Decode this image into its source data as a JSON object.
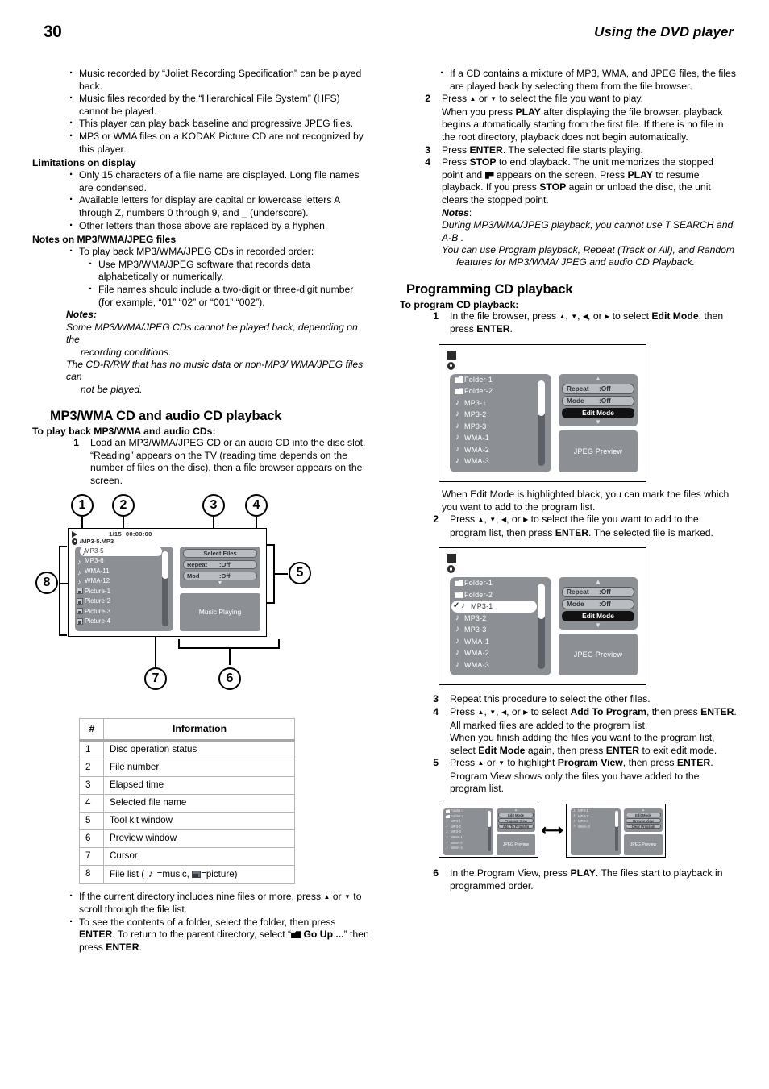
{
  "header": {
    "page_number": "30",
    "title": "Using the DVD player"
  },
  "left": {
    "top_bullets": [
      "Music recorded by “Joliet Recording Specification” can be played back.",
      "Music files recorded by the “Hierarchical File System” (HFS) cannot be played.",
      "This player can play back baseline and progressive JPEG files.",
      "MP3 or WMA files on a KODAK Picture CD are not recognized by this player."
    ],
    "limitations_heading": "Limitations on display",
    "limitations_bullets": [
      "Only 15 characters of a file name are displayed. Long file names are condensed.",
      "Available letters for display are capital or lowercase letters A through Z, numbers 0 through 9, and _ (underscore).",
      "Other letters than those above are replaced by a hyphen."
    ],
    "notes_heading": "Notes on MP3/WMA/JPEG files",
    "notes_bullet": "To play back MP3/WMA/JPEG CDs in recorded order:",
    "notes_subbullets": [
      "Use MP3/WMA/JPEG software that records data alphabetically or numerically.",
      "File names should include a two-digit or three-digit number (for example, “01” “02” or “001” “002”)."
    ],
    "notes_label": "Notes:",
    "notes_italic": [
      {
        "main": "Some MP3/WMA/JPEG CDs cannot be played back, depending on the",
        "indent": "recording conditions."
      },
      {
        "main": "The CD-R/RW that has no music data or non-MP3/ WMA/JPEG files can",
        "indent": "not be played."
      }
    ],
    "section_title": "MP3/WMA CD and audio CD playback",
    "procedure_heading": "To play back MP3/WMA and audio CDs:",
    "step1_num": "1",
    "step1_text": "Load an MP3/WMA/JPEG CD or an audio CD into the disc slot. “Reading” appears on the TV (reading time depends on the number of files on the disc), then a file browser appears on the screen.",
    "bottom_bullets": [
      {
        "pre": "If the current directory includes nine files or more, press ",
        "post": " to scroll through the file list."
      },
      {
        "pre": "To see the contents of a folder, select the folder, then press ",
        "bold1": "ENTER",
        "mid": ". To return to the parent directory, select ",
        "quote_bold": "Go Up ...",
        "post": " then press ",
        "bold2": "ENTER",
        "end": "."
      }
    ]
  },
  "diagram": {
    "callouts": [
      "1",
      "2",
      "3",
      "4",
      "5",
      "6",
      "7",
      "8"
    ],
    "status_icon": "play-icon",
    "file_number": "1/15",
    "elapsed_time": "00:00:00",
    "selected_file": "/MP3-5.MP3",
    "files": [
      {
        "label": "MP3-5",
        "kind": "music",
        "selected": true
      },
      {
        "label": "MP3-6",
        "kind": "music",
        "selected": false
      },
      {
        "label": "WMA-11",
        "kind": "music",
        "selected": false
      },
      {
        "label": "WMA-12",
        "kind": "music",
        "selected": false
      },
      {
        "label": "Picture-1",
        "kind": "picture",
        "selected": false
      },
      {
        "label": "Picture-2",
        "kind": "picture",
        "selected": false
      },
      {
        "label": "Picture-3",
        "kind": "picture",
        "selected": false
      },
      {
        "label": "Picture-4",
        "kind": "picture",
        "selected": false
      }
    ],
    "toolkit": {
      "select_files": "Select Files",
      "repeat_label": "Repeat",
      "repeat_value": ":Off",
      "mod_label": "Mod",
      "mod_value": ":Off"
    },
    "preview_text": "Music Playing"
  },
  "table": {
    "col_num": "#",
    "col_info": "Information",
    "rows": [
      {
        "n": "1",
        "info": "Disc operation status"
      },
      {
        "n": "2",
        "info": "File number"
      },
      {
        "n": "3",
        "info": "Elapsed time"
      },
      {
        "n": "4",
        "info": "Selected file name"
      },
      {
        "n": "5",
        "info": "Tool kit window"
      },
      {
        "n": "6",
        "info": "Preview window"
      },
      {
        "n": "7",
        "info": "Cursor"
      },
      {
        "n": "8",
        "info_pre": "File list ( ",
        "info_mid": " =music, ",
        "info_end": "=picture)"
      }
    ]
  },
  "right": {
    "top_bullet": "If a CD contains a mixture of MP3, WMA, and JPEG files, the files are played back by selecting them from the file browser.",
    "step2_num": "2",
    "step2_pre": "Press ",
    "step2_mid": " or ",
    "step2_post": " to select the file you want to play.",
    "step2_cont_a": "When you press ",
    "step2_cont_play": "PLAY",
    "step2_cont_b": " after displaying the file browser, playback begins automatically starting from the first file. If there is no file in the root directory, playback does not begin automatically.",
    "step3_num": "3",
    "step3_pre": "Press ",
    "step3_enter": "ENTER",
    "step3_post": ". The selected file starts playing.",
    "step4_num": "4",
    "step4_a": "Press ",
    "step4_stop": "STOP",
    "step4_b": " to end playback. The unit memorizes the stopped point and ",
    "step4_c": " appears on the screen. Press ",
    "step4_play": "PLAY",
    "step4_d": " to resume playback. If you press ",
    "step4_stop2": "STOP",
    "step4_e": " again or unload the disc, the unit clears the stopped point.",
    "notes_label": "Notes",
    "notes_colon": ":",
    "notes_italic": [
      {
        "main": "During MP3/WMA/JPEG playback, you cannot use T.SEARCH and A-B .",
        "indent": ""
      },
      {
        "main": "You can use Program playback, Repeat (Track or All), and Random",
        "indent": "features for MP3/WMA/ JPEG and audio CD Playback."
      }
    ],
    "section_title": "Programming CD playback",
    "procedure_heading": "To program CD playback:",
    "p_step1_num": "1",
    "p_step1_a": "In the file browser, press ",
    "p_step1_b": ", ",
    "p_step1_c": ", or ",
    "p_step1_d": " to select ",
    "p_step1_edit": "Edit Mode",
    "p_step1_e": ", then press ",
    "p_step1_enter": "ENTER",
    "p_step1_f": ".",
    "after_screen1": "When Edit Mode is highlighted black, you can mark the files which you want to add to the program list.",
    "p_step2_num": "2",
    "p_step2_a": "Press ",
    "p_step2_b": " to select the file you want to add to the program list, then press ",
    "p_step2_enter": "ENTER",
    "p_step2_c": ". The selected file is marked.",
    "p_step3_num": "3",
    "p_step3_text": "Repeat this procedure to select the other files.",
    "p_step4_num": "4",
    "p_step4_a": "Press ",
    "p_step4_b": " to select ",
    "p_step4_add": "Add To Program",
    "p_step4_c": ", then press ",
    "p_step4_enter": "ENTER",
    "p_step4_d": ". All marked files are added to the program list.",
    "p_step4_cont_a": "When you finish adding the files you want to the program list, select ",
    "p_step4_cont_edit": "Edit Mode",
    "p_step4_cont_b": " again, then press ",
    "p_step4_cont_enter": "ENTER",
    "p_step4_cont_c": " to exit edit mode.",
    "p_step5_num": "5",
    "p_step5_a": "Press ",
    "p_step5_b": " or ",
    "p_step5_c": " to highlight ",
    "p_step5_pv": "Program View",
    "p_step5_d": ", then press ",
    "p_step5_enter": "ENTER",
    "p_step5_e": ". Program View shows only the files you have added to the program list.",
    "p_step6_num": "6",
    "p_step6_a": "In the Program View, press ",
    "p_step6_play": "PLAY",
    "p_step6_b": ". The files start to playback in programmed order."
  },
  "screen1": {
    "files": [
      {
        "label": "Folder-1",
        "kind": "folder",
        "selected": false,
        "checked": false
      },
      {
        "label": "Folder-2",
        "kind": "folder",
        "selected": false,
        "checked": false
      },
      {
        "label": "MP3-1",
        "kind": "music",
        "selected": false,
        "checked": false
      },
      {
        "label": "MP3-2",
        "kind": "music",
        "selected": false,
        "checked": false
      },
      {
        "label": "MP3-3",
        "kind": "music",
        "selected": false,
        "checked": false
      },
      {
        "label": "WMA-1",
        "kind": "music",
        "selected": false,
        "checked": false
      },
      {
        "label": "WMA-2",
        "kind": "music",
        "selected": false,
        "checked": false
      },
      {
        "label": "WMA-3",
        "kind": "music",
        "selected": false,
        "checked": false
      }
    ],
    "repeat_label": "Repeat",
    "repeat_value": ":Off",
    "mode_label": "Mode",
    "mode_value": ":Off",
    "edit_mode": "Edit Mode",
    "preview": "JPEG Preview"
  },
  "screen2": {
    "files": [
      {
        "label": "Folder-1",
        "kind": "folder",
        "selected": false,
        "checked": false
      },
      {
        "label": "Folder-2",
        "kind": "folder",
        "selected": false,
        "checked": false
      },
      {
        "label": "MP3-1",
        "kind": "music",
        "selected": true,
        "checked": true
      },
      {
        "label": "MP3-2",
        "kind": "music",
        "selected": false,
        "checked": false
      },
      {
        "label": "MP3-3",
        "kind": "music",
        "selected": false,
        "checked": false
      },
      {
        "label": "WMA-1",
        "kind": "music",
        "selected": false,
        "checked": false
      },
      {
        "label": "WMA-2",
        "kind": "music",
        "selected": false,
        "checked": false
      },
      {
        "label": "WMA-3",
        "kind": "music",
        "selected": false,
        "checked": false
      }
    ],
    "repeat_label": "Repeat",
    "repeat_value": ":Off",
    "mode_label": "Mode",
    "mode_value": ":Off",
    "edit_mode": "Edit Mode",
    "preview": "JPEG Preview"
  },
  "mini_left": {
    "files": [
      "Folder-1",
      "Folder-2",
      "MP3-1",
      "MP3-2",
      "MP3-3",
      "WMA-1",
      "WMA-2",
      "WMA-3"
    ],
    "kinds": [
      "folder",
      "folder",
      "music",
      "music",
      "music",
      "music",
      "music",
      "music"
    ],
    "btn1": "Edit Mode",
    "btn2": "Program View",
    "btn3": "Add To Program",
    "preview": "JPEG Preview"
  },
  "mini_right": {
    "files": [
      "MP3-1",
      "MP3-2",
      "MP3-3",
      "WMA-3"
    ],
    "kinds": [
      "music",
      "music",
      "music",
      "music"
    ],
    "btn1": "Edit Mode",
    "btn2": "Browse View",
    "btn3": "Clear Program",
    "preview": "JPEG Preview"
  }
}
